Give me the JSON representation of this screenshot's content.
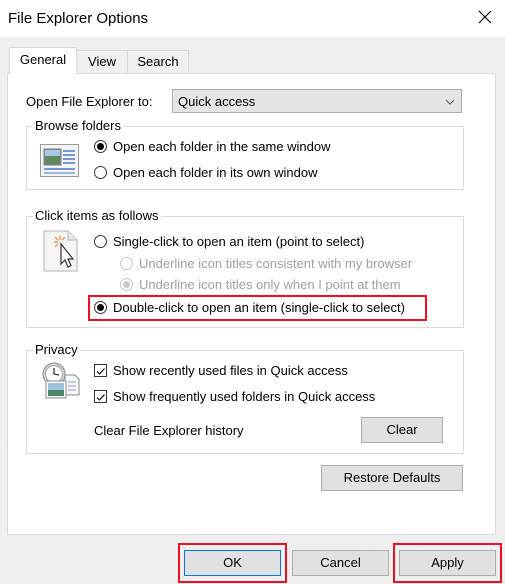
{
  "window": {
    "title": "File Explorer Options",
    "close_icon": "close-icon"
  },
  "tabs": [
    {
      "label": "General",
      "active": true
    },
    {
      "label": "View",
      "active": false
    },
    {
      "label": "Search",
      "active": false
    }
  ],
  "general": {
    "open_to": {
      "label": "Open File Explorer to:",
      "value": "Quick access",
      "icon": "chevron-down-icon"
    },
    "browse_folders": {
      "title": "Browse folders",
      "icon": "folder-window-icon",
      "options": [
        {
          "label": "Open each folder in the same window",
          "checked": true
        },
        {
          "label": "Open each folder in its own window",
          "checked": false
        }
      ]
    },
    "click_items": {
      "title": "Click items as follows",
      "icon": "click-cursor-icon",
      "single_click": {
        "label": "Single-click to open an item (point to select)",
        "checked": false
      },
      "sub_options": [
        {
          "label": "Underline icon titles consistent with my browser",
          "checked": false,
          "disabled": true
        },
        {
          "label": "Underline icon titles only when I point at them",
          "checked": true,
          "disabled": true
        }
      ],
      "double_click": {
        "label": "Double-click to open an item (single-click to select)",
        "checked": true
      }
    },
    "privacy": {
      "title": "Privacy",
      "icon": "recent-files-clock-icon",
      "checkboxes": [
        {
          "label": "Show recently used files in Quick access",
          "checked": true
        },
        {
          "label": "Show frequently used folders in Quick access",
          "checked": true
        }
      ],
      "clear_history_label": "Clear File Explorer history",
      "clear_button": "Clear"
    },
    "restore_defaults": "Restore Defaults"
  },
  "footer": {
    "ok": "OK",
    "cancel": "Cancel",
    "apply": "Apply"
  },
  "colors": {
    "highlight": "#e81123",
    "default_button_border": "#0078d7",
    "dialog_bg": "#f0f0f0"
  }
}
